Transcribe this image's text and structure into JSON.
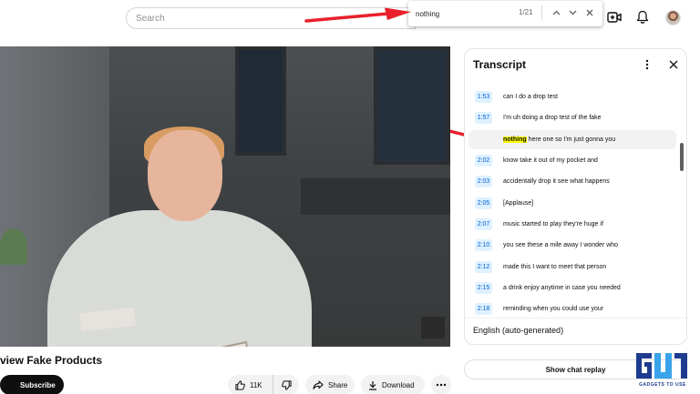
{
  "header": {
    "search_placeholder": "Search",
    "icons": [
      "create-icon",
      "bell-icon",
      "avatar"
    ]
  },
  "find_bar": {
    "query": "nothing",
    "match_count": "1/21"
  },
  "video": {
    "title": "view Fake Products",
    "subscribe_label": "Subscribe",
    "like_count": "11K",
    "share_label": "Share",
    "download_label": "Download"
  },
  "transcript": {
    "title": "Transcript",
    "segments": [
      {
        "time": "",
        "text": ""
      },
      {
        "time": "1:53",
        "text": "can I do a drop test"
      },
      {
        "time": "1:57",
        "text": "I'm uh doing a drop test of the fake"
      },
      {
        "time": "",
        "highlight": "nothing",
        "text": " here one so I'm just gonna you"
      },
      {
        "time": "2:02",
        "text": "know take it out of my pocket and"
      },
      {
        "time": "2:03",
        "text": "accidentally drop it see what happens"
      },
      {
        "time": "2:05",
        "text": "[Applause]"
      },
      {
        "time": "2:07",
        "text": "music started to play they're huge if"
      },
      {
        "time": "2:10",
        "text": "you see these a mile away I wonder who"
      },
      {
        "time": "2:12",
        "text": "made this I want to meet that person"
      },
      {
        "time": "2:15",
        "text": "a drink enjoy anytime in case you needed"
      },
      {
        "time": "2:18",
        "text": "reminding when you could use your"
      }
    ],
    "language": "English (auto-generated)"
  },
  "chat": {
    "replay_label": "Show chat replay"
  },
  "brand": {
    "tagline": "GADGETS TO USE"
  },
  "colors": {
    "arrow": "#e8202a",
    "timestamp_bg": "#def1ff",
    "timestamp_text": "#065fd4",
    "highlight": "#ffff00"
  }
}
